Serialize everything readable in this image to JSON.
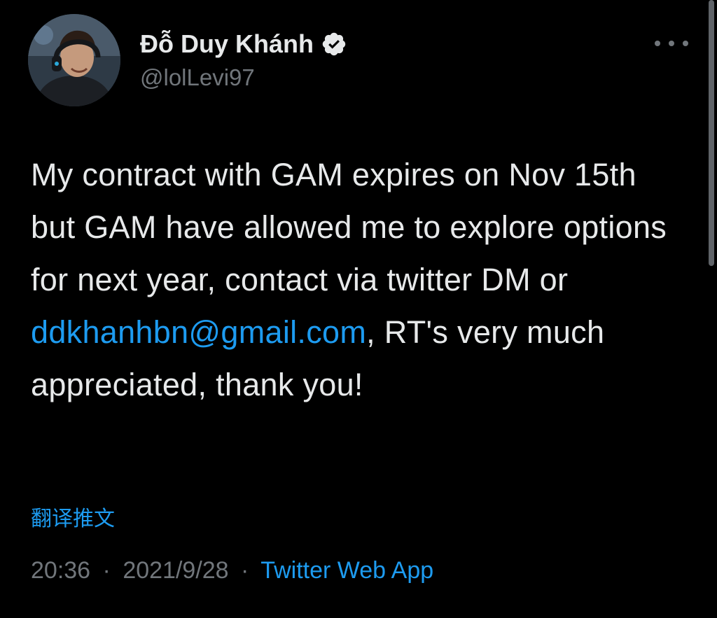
{
  "author": {
    "display_name": "Đỗ Duy Khánh",
    "handle": "@lolLevi97",
    "verified": true,
    "avatar_icon": "profile-photo"
  },
  "tweet": {
    "text_before_link": "My contract with GAM expires on Nov 15th but GAM have allowed me to explore options for next year, contact via twitter DM or ",
    "link_text": "ddkhanhbn@gmail.com",
    "text_after_link": ", RT's very much appreciated, thank you!"
  },
  "translate_label": "翻译推文",
  "meta": {
    "time": "20:36",
    "separator": "·",
    "date": "2021/9/28",
    "source": "Twitter Web App"
  },
  "colors": {
    "background": "#000000",
    "text": "#e7e9ea",
    "secondary": "#71767b",
    "accent": "#1d9bf0"
  }
}
